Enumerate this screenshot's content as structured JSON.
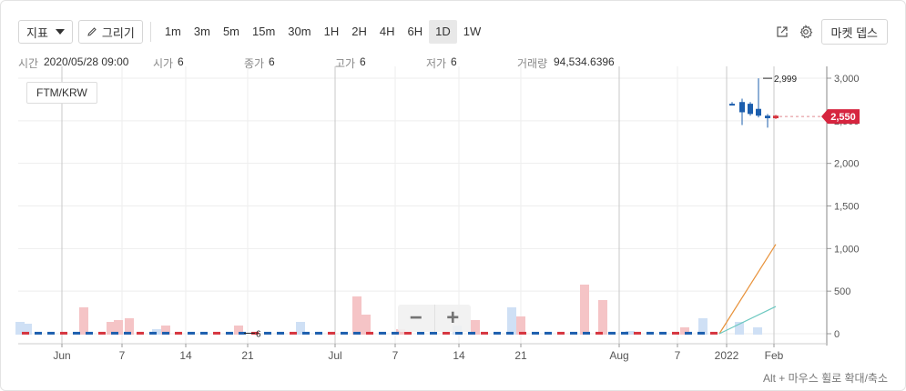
{
  "toolbar": {
    "indicator_label": "지표",
    "draw_label": "그리기",
    "intervals": [
      "1m",
      "3m",
      "5m",
      "15m",
      "30m",
      "1H",
      "2H",
      "4H",
      "6H",
      "1D",
      "1W"
    ],
    "active_interval": "1D",
    "market_depth_label": "마켓 뎁스"
  },
  "info": {
    "time_label": "시간",
    "time_value": "2020/05/28 09:00",
    "open_label": "시가",
    "open_value": "6",
    "close_label": "종가",
    "close_value": "6",
    "high_label": "고가",
    "high_value": "6",
    "low_label": "저가",
    "low_value": "6",
    "volume_label": "거래량",
    "volume_value": "94,534.6396"
  },
  "pair_label": "FTM/KRW",
  "zoom": {
    "out": "−",
    "in": "+"
  },
  "hint": "Alt + 마우스 휠로 확대/축소",
  "colors": {
    "up": "#d6353f",
    "down": "#1d5fae",
    "up_vol": "#f5c4c6",
    "down_vol": "#cfe0f5",
    "ma1": "#e8923a",
    "ma2": "#6cc8c0",
    "grid": "#eeeeee"
  },
  "chart_data": {
    "type": "candlestick",
    "pair": "FTM/KRW",
    "y_axis": {
      "ticks": [
        0,
        500,
        1000,
        1500,
        2000,
        2500,
        3000
      ],
      "tick_labels": [
        "0",
        "500",
        "1,000",
        "1,500",
        "2,000",
        "2,500",
        "3,000"
      ],
      "ylim": [
        -50,
        3100
      ]
    },
    "x_axis": {
      "tick_labels": [
        "Jun",
        "7",
        "14",
        "21",
        "Jul",
        "7",
        "14",
        "21",
        "Aug",
        "7",
        "2022",
        "Feb"
      ]
    },
    "current_price": 2550,
    "current_price_label": "2,550",
    "high_label": "2,999",
    "low_label": "6",
    "candles": [
      {
        "o": 2700,
        "h": 2720,
        "l": 2690,
        "c": 2690,
        "up": false
      },
      {
        "o": 2720,
        "h": 2760,
        "l": 2450,
        "c": 2600,
        "up": false
      },
      {
        "o": 2700,
        "h": 2720,
        "l": 2560,
        "c": 2580,
        "up": false
      },
      {
        "o": 2640,
        "h": 2999,
        "l": 2540,
        "c": 2560,
        "up": false
      },
      {
        "o": 2560,
        "h": 2580,
        "l": 2420,
        "c": 2530,
        "up": false
      },
      {
        "o": 2530,
        "h": 2570,
        "l": 2520,
        "c": 2560,
        "up": true
      }
    ],
    "ma_series": [
      {
        "color_key": "ma1",
        "values": [
          0,
          1050
        ]
      },
      {
        "color_key": "ma2",
        "values": [
          0,
          320
        ]
      }
    ]
  }
}
